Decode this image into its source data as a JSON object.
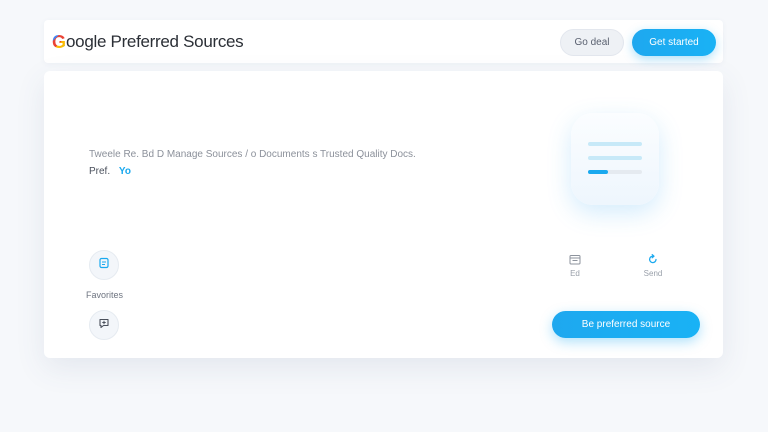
{
  "header": {
    "brand_first_letter": "G",
    "brand_rest": "oogle Preferred Sources",
    "ghost_button_label": "Go deal",
    "primary_button_label": "Get started"
  },
  "card": {
    "description": "Tweele  Re.  Bd  D  Manage Sources  /  o  Documents  s  Trusted  Quality  Docs.",
    "pref_label": "Pref.",
    "pref_value": "Yo",
    "widget_progress": 0.37,
    "icon_button_label": "Favorites",
    "stats": [
      "Ed",
      "Send"
    ],
    "cta_label": "Be preferred source"
  },
  "colors": {
    "accent": "#1aa9ef",
    "google_blue": "#4285F4"
  },
  "icons": [
    "document-icon",
    "add-chat-icon",
    "calendar-icon",
    "reload-icon"
  ]
}
